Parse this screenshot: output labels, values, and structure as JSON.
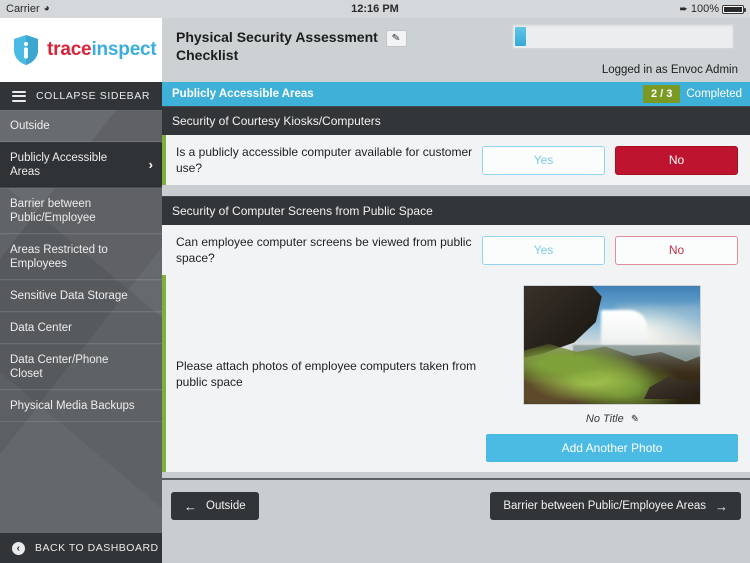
{
  "statusbar": {
    "carrier": "Carrier",
    "wifi_icon": "wifi-icon",
    "time": "12:16 PM",
    "location_icon": "location-arrow-icon",
    "battery": "100%"
  },
  "brand": {
    "logo_icon": "shield-info-logo",
    "name_part1": "trace",
    "name_part2": "inspect"
  },
  "sidebar": {
    "collapse_label": "COLLAPSE SIDEBAR",
    "menu_icon": "hamburger-icon",
    "items": [
      {
        "label": "Outside",
        "active": false
      },
      {
        "label": "Publicly Accessible Areas",
        "active": true
      },
      {
        "label": "Barrier between Public/Employee",
        "active": false
      },
      {
        "label": "Areas Restricted to Employees",
        "active": false
      },
      {
        "label": "Sensitive Data Storage",
        "active": false
      },
      {
        "label": "Data Center",
        "active": false
      },
      {
        "label": "Data Center/Phone Closet",
        "active": false
      },
      {
        "label": "Physical Media Backups",
        "active": false
      }
    ],
    "chevron": "›",
    "back_label": "BACK TO DASHBOARD",
    "back_icon": "back-circle-icon"
  },
  "topbar": {
    "title": "Physical Security Assessment Checklist",
    "edit_icon": "pencil-icon",
    "progress_percent": 5,
    "logged_in": "Logged in as Envoc Admin"
  },
  "section": {
    "title": "Publicly Accessible Areas",
    "count": "2 / 3",
    "completed_label": "Completed"
  },
  "groups": [
    {
      "title": "Security of Courtesy Kiosks/Computers",
      "question": "Is a publicly accessible computer available for customer use?",
      "yes_label": "Yes",
      "no_label": "No",
      "answer": "No"
    },
    {
      "title": "Security of Computer Screens from Public Space",
      "question": "Can employee computer screens be viewed from public space?",
      "yes_label": "Yes",
      "no_label": "No",
      "answer": ""
    }
  ],
  "photo": {
    "prompt": "Please attach photos of employee computers taken from public space",
    "caption": "No Title",
    "caption_edit_icon": "pencil-icon",
    "add_label": "Add Another Photo",
    "thumbnail_alt": "waterfall-landscape-photo"
  },
  "footer": {
    "prev_label": "Outside",
    "prev_icon": "arrow-left-icon",
    "next_label": "Barrier between Public/Employee Areas",
    "next_icon": "arrow-right-icon"
  },
  "colors": {
    "accent_teal": "#3fb0d8",
    "badge_green": "#7a9a23",
    "danger_red": "#bf1430",
    "row_accent_green": "#7fb03a",
    "sidebar_gray": "#5d6063",
    "brand_red": "#d9243a",
    "brand_blue": "#3aaedb"
  }
}
